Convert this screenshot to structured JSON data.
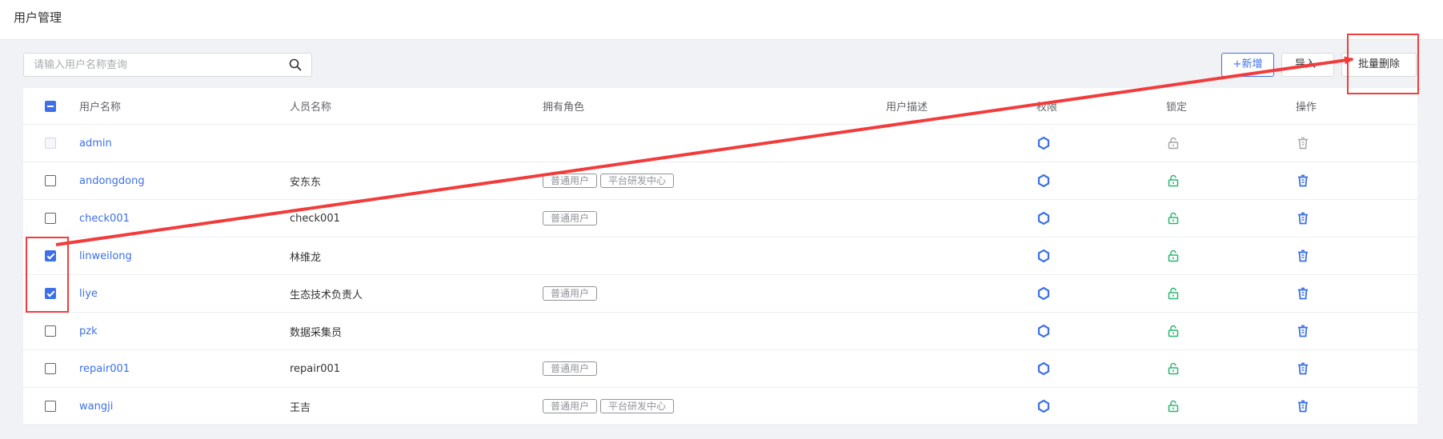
{
  "page": {
    "title": "用户管理"
  },
  "search": {
    "placeholder": "请输入用户名称查询",
    "icon": "search-icon"
  },
  "toolbar": {
    "add_label": "+新增",
    "import_label": "导入",
    "batch_delete_label": "批量删除"
  },
  "colors": {
    "accent": "#3c6fe8",
    "unlocked": "#2bb673",
    "annotation": "#f23c3c"
  },
  "table": {
    "columns": [
      "用户名称",
      "人员名称",
      "拥有角色",
      "用户描述",
      "权限",
      "锁定",
      "操作"
    ],
    "header_checkbox": "indeterminate",
    "rows": [
      {
        "username": "admin",
        "name": "",
        "roles": [],
        "desc": "",
        "checked": false,
        "disabled": true
      },
      {
        "username": "andongdong",
        "name": "安东东",
        "roles": [
          "普通用户",
          "平台研发中心"
        ],
        "desc": "",
        "checked": false,
        "disabled": false
      },
      {
        "username": "check001",
        "name": "check001",
        "roles": [
          "普通用户"
        ],
        "desc": "",
        "checked": false,
        "disabled": false
      },
      {
        "username": "linweilong",
        "name": "林维龙",
        "roles": [],
        "desc": "",
        "checked": true,
        "disabled": false
      },
      {
        "username": "liye",
        "name": "生态技术负责人",
        "roles": [
          "普通用户"
        ],
        "desc": "",
        "checked": true,
        "disabled": false
      },
      {
        "username": "pzk",
        "name": "数据采集员",
        "roles": [],
        "desc": "",
        "checked": false,
        "disabled": false
      },
      {
        "username": "repair001",
        "name": "repair001",
        "roles": [
          "普通用户"
        ],
        "desc": "",
        "checked": false,
        "disabled": false
      },
      {
        "username": "wangji",
        "name": "王吉",
        "roles": [
          "普通用户",
          "平台研发中心"
        ],
        "desc": "",
        "checked": false,
        "disabled": false
      }
    ]
  }
}
